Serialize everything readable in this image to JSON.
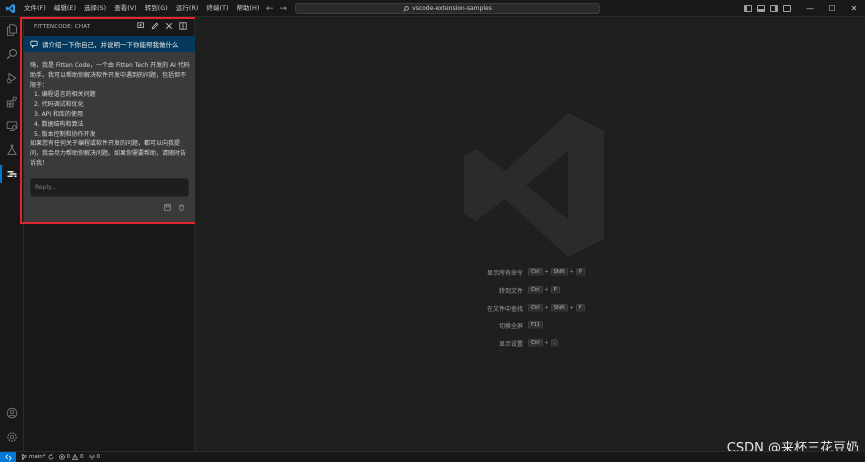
{
  "titlebar": {
    "menus": [
      "文件(F)",
      "编辑(E)",
      "选择(S)",
      "查看(V)",
      "转到(G)",
      "运行(R)",
      "终端(T)",
      "帮助(H)"
    ],
    "search_text": "vscode-extension-samples",
    "nav_back": "←",
    "nav_forward": "→",
    "win_minimize": "—",
    "win_maximize": "☐",
    "win_close": "✕",
    "accent_color": "#0078d4"
  },
  "activitybar": {
    "icons": [
      "files-icon",
      "search-icon",
      "run-debug-icon",
      "extensions-icon",
      "remote-explorer-icon",
      "testing-icon",
      "fittencode-icon",
      "account-icon",
      "settings-gear-icon"
    ],
    "active": "fittencode-icon"
  },
  "chat": {
    "title": "FITTENCODE: CHAT",
    "user_message": "请介绍一下你自己，并说明一下你能帮我做什么",
    "reply_intro": "嗨，我是 Fitten Code，一个由 Fitten Tech 开发的 AI 代码助手。我可以帮助你解决软件开发中遇到的问题，包括但不限于：",
    "reply_list": [
      "1. 编程语言的相关问题",
      "2. 代码调试和优化",
      "3. API 和库的使用",
      "4. 数据结构和算法",
      "5. 版本控制和协作开发"
    ],
    "reply_outro": "如果您有任何关于编程或软件开发的问题，都可以向我提问，我会尽力帮助你解决问题。如果你需要帮助，请随时告诉我！",
    "input_placeholder": "Reply..."
  },
  "editor": {
    "shortcuts": [
      {
        "label": "显示所有命令",
        "keys": [
          "Ctrl",
          "Shift",
          "P"
        ]
      },
      {
        "label": "转到文件",
        "keys": [
          "Ctrl",
          "P"
        ]
      },
      {
        "label": "在文件中查找",
        "keys": [
          "Ctrl",
          "Shift",
          "F"
        ]
      },
      {
        "label": "切换全屏",
        "keys": [
          "F11"
        ]
      },
      {
        "label": "显示设置",
        "keys": [
          "Ctrl",
          ","
        ]
      }
    ],
    "watermark": "CSDN @来杯三花豆奶"
  },
  "statusbar": {
    "branch": "main*",
    "errors": "0",
    "warnings": "0",
    "ports": "0"
  }
}
